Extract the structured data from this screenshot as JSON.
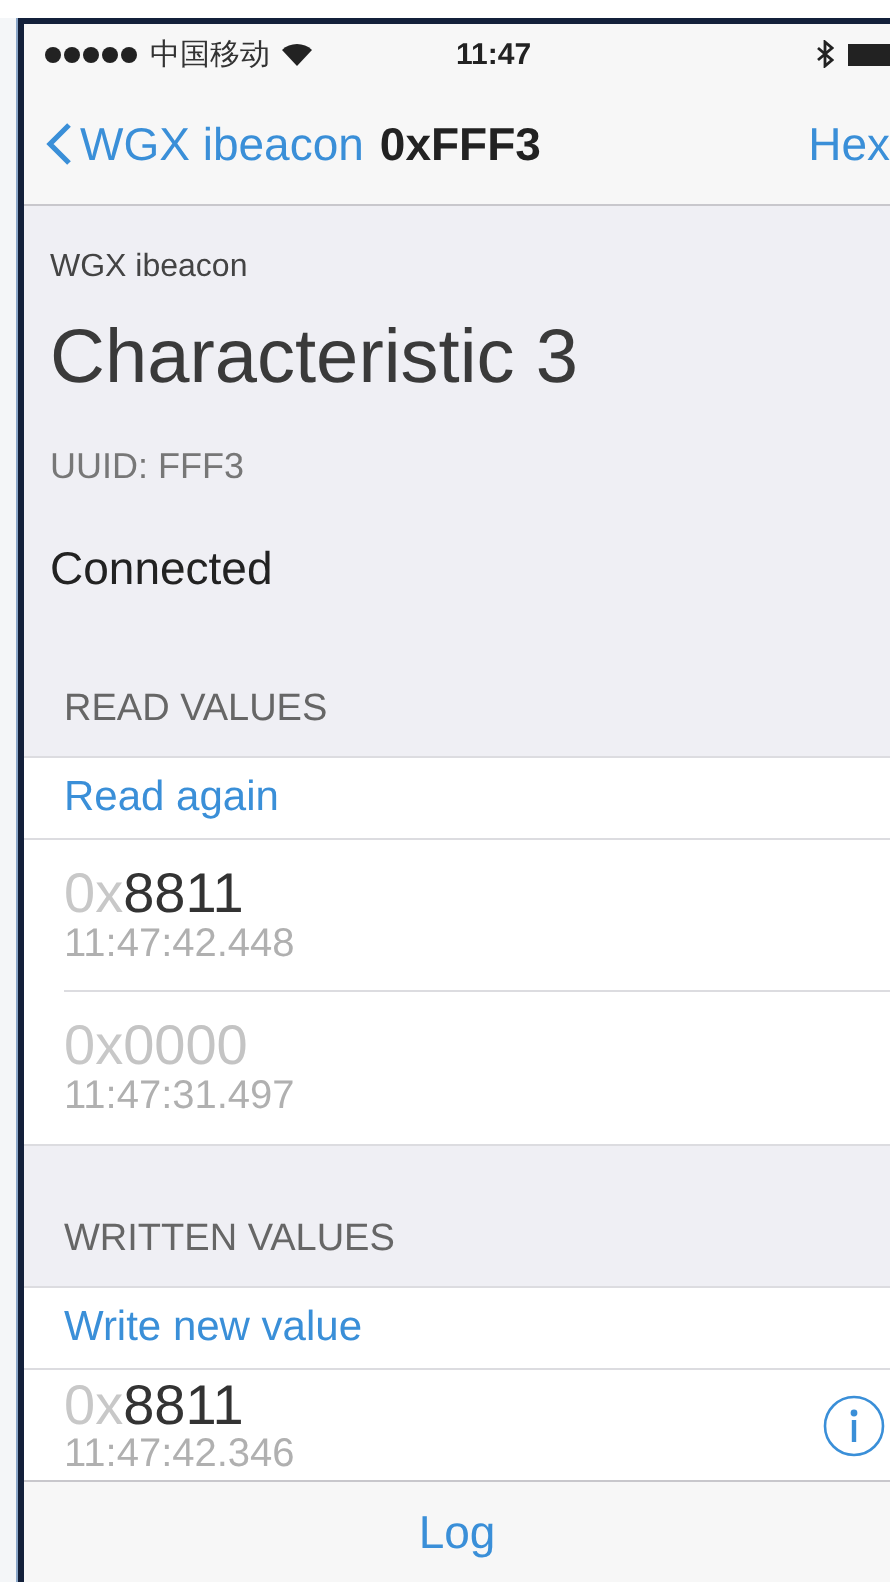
{
  "status_bar": {
    "carrier": "中国移动",
    "time": "11:47"
  },
  "nav": {
    "back": "WGX ibeacon",
    "title": "0xFFF3",
    "action": "Hex"
  },
  "header": {
    "device": "WGX ibeacon",
    "name": "Characteristic 3",
    "uuid": "UUID: FFF3",
    "state": "Connected"
  },
  "sections": [
    {
      "title": "READ VALUES",
      "action": "Read again",
      "values": [
        {
          "prefix": "0x",
          "value": "8811",
          "time": "11:47:42.448",
          "faded": false,
          "info": false
        },
        {
          "prefix": "0x",
          "value": "0000",
          "time": "11:47:31.497",
          "faded": true,
          "info": false
        }
      ]
    },
    {
      "title": "WRITTEN VALUES",
      "action": "Write new value",
      "values": [
        {
          "prefix": "0x",
          "value": "8811",
          "time": "11:47:42.346",
          "faded": false,
          "info": true
        }
      ]
    }
  ],
  "toolbar": {
    "button": "Log"
  }
}
